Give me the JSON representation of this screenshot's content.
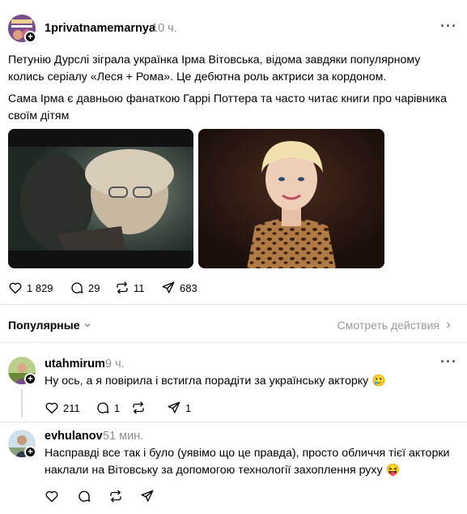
{
  "post": {
    "username": "1privatnamemarnya",
    "time": "10 ч.",
    "paragraph1": "Петунію Дурслі зіграла українка Ірма Вітовська, відома завдяки популярному колись серіалу «Леся + Рома». Це дебютна роль актриси за кордоном.",
    "paragraph2": "Сама Ірма є давньою фанаткою Гаррі Поттера та часто читає книги про чарівника своїм дітям",
    "likes": "1 829",
    "replies": "29",
    "reposts": "11",
    "shares": "683"
  },
  "sort": {
    "label": "Популярные",
    "view_activity": "Смотреть действия"
  },
  "comments": [
    {
      "username": "utahmirum",
      "time": "9 ч.",
      "text": "Ну ось, а я повірила і встигла порадіти за українську акторку 🥲",
      "likes": "211",
      "replies": "1",
      "reposts": "",
      "shares": "1"
    },
    {
      "username": "evhulanov",
      "time": "51 мин.",
      "text": "Насправді все так і було (уявімо що це правда), просто обличчя тієї акторки наклали на Вітовську за допомогою технології захоплення руху 😝",
      "likes": "",
      "replies": "",
      "reposts": "",
      "shares": ""
    }
  ],
  "icons": {
    "more": "more-icon",
    "like": "heart-icon",
    "reply": "comment-icon",
    "repost": "repost-icon",
    "share": "send-icon",
    "chevron": "chevron-down-icon",
    "chevron_right": "chevron-right-icon"
  }
}
